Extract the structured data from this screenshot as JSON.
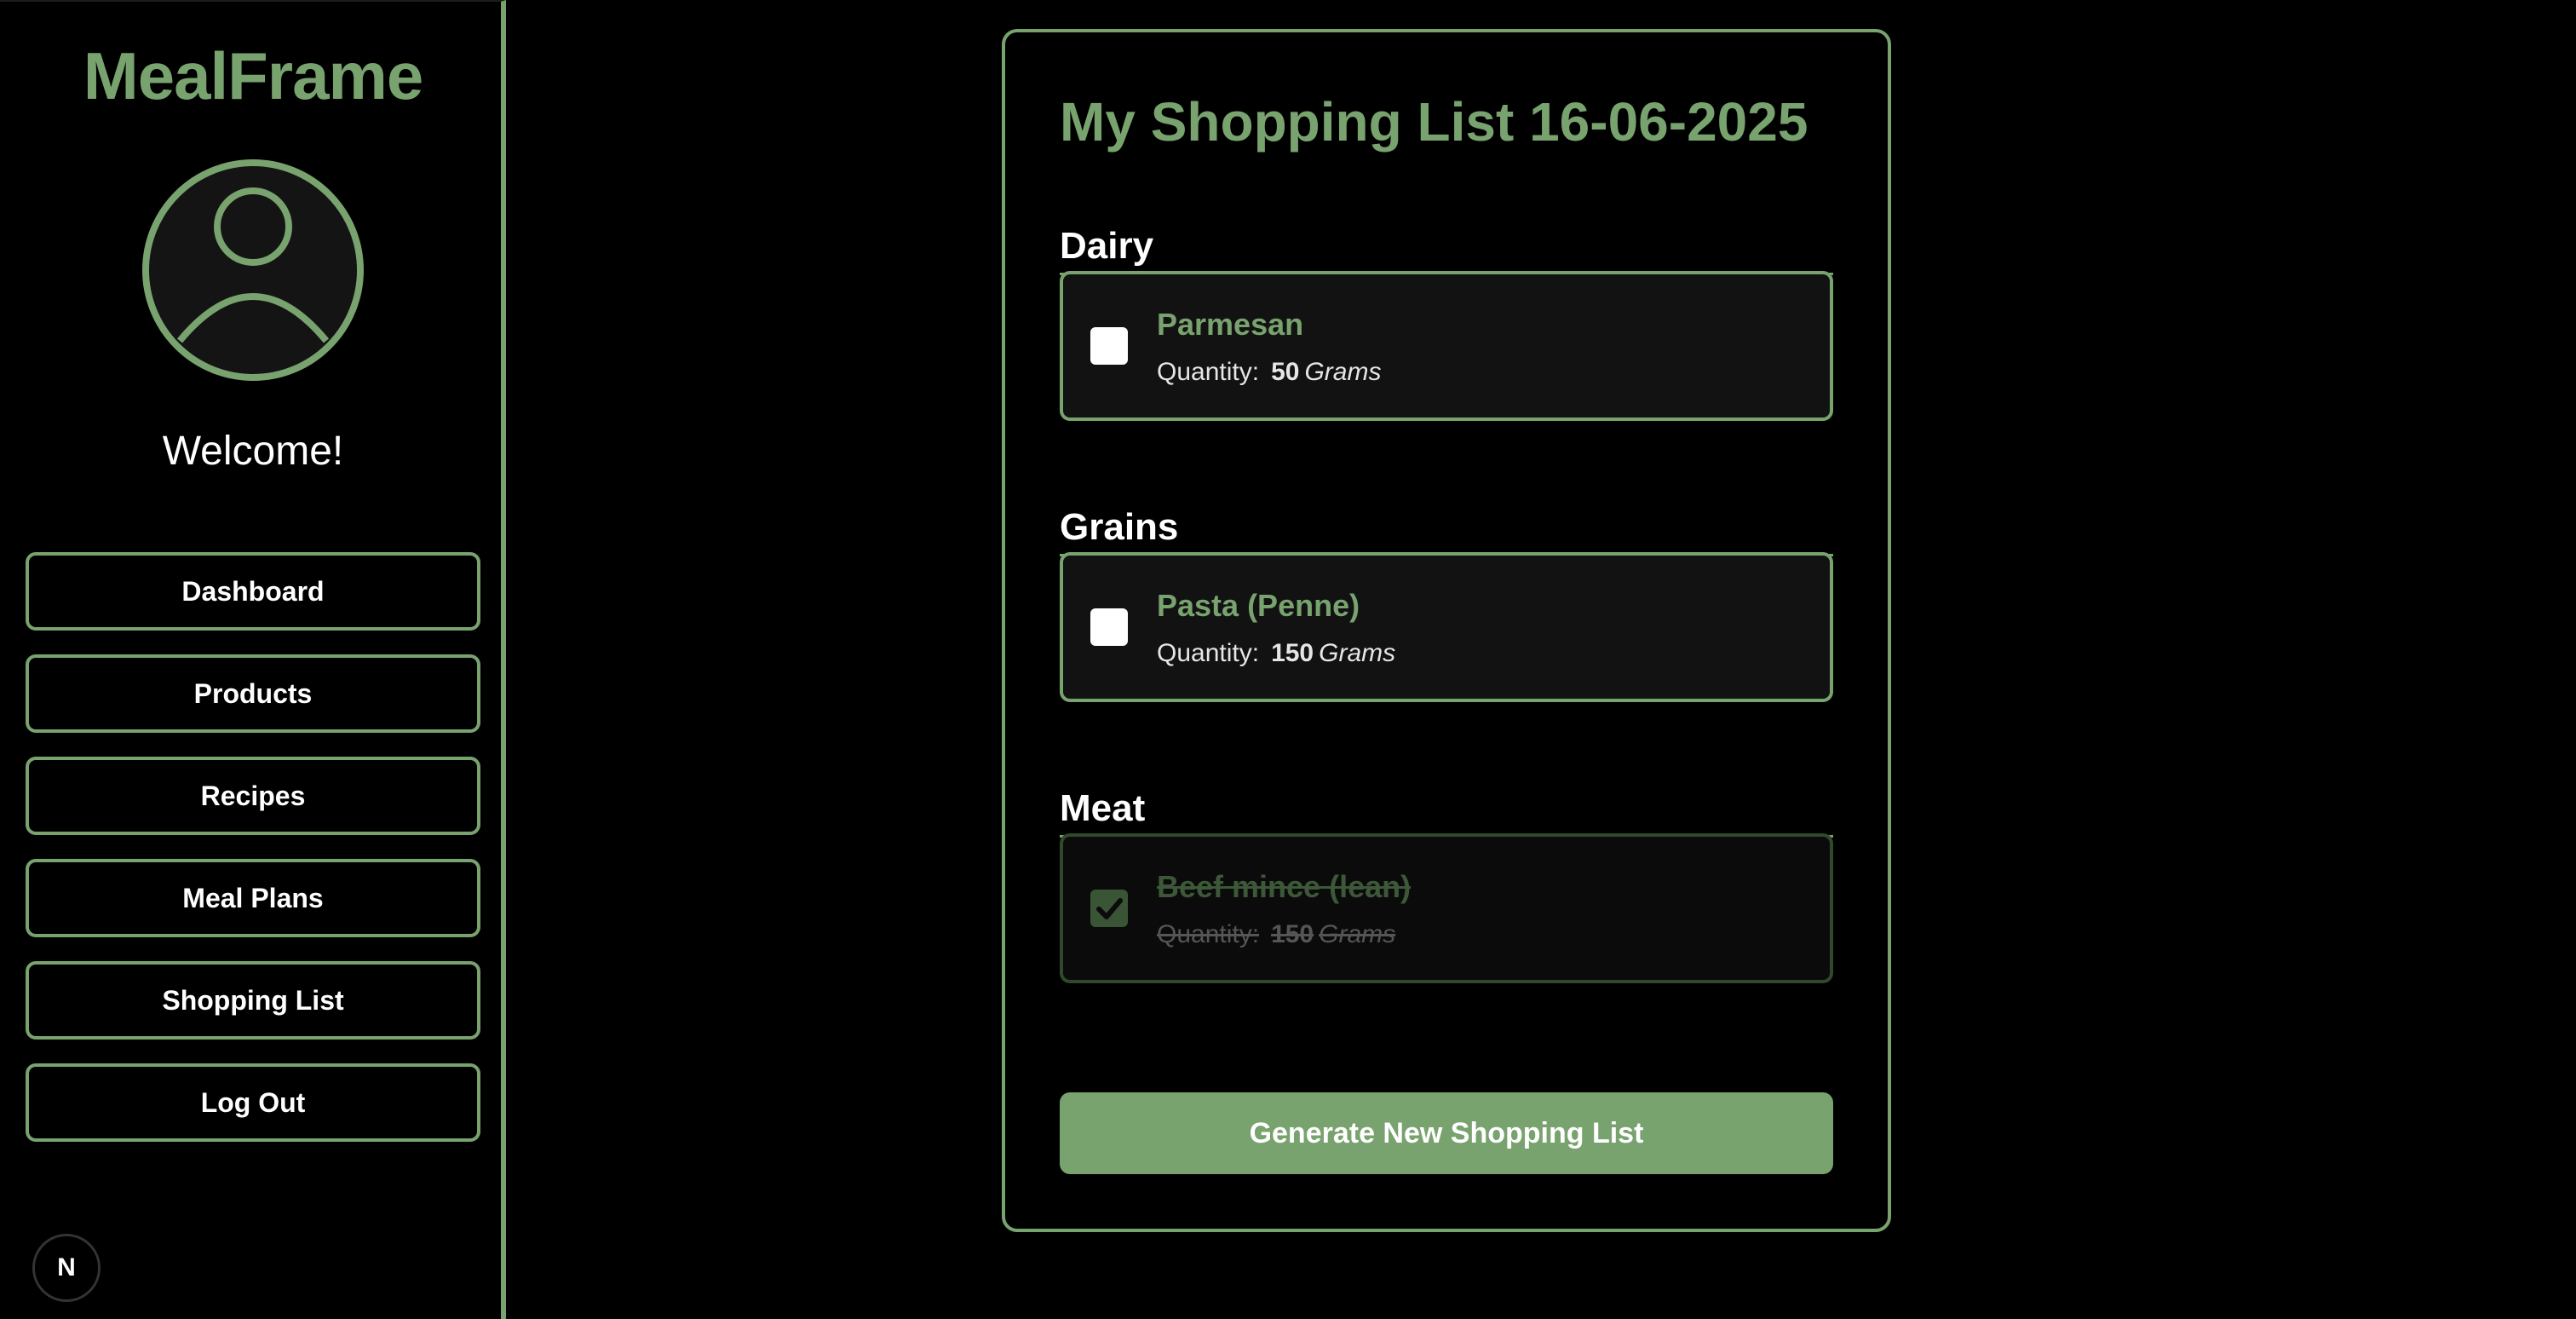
{
  "sidebar": {
    "brand": "MealFrame",
    "welcome": "Welcome!",
    "nav": [
      {
        "label": "Dashboard"
      },
      {
        "label": "Products"
      },
      {
        "label": "Recipes"
      },
      {
        "label": "Meal Plans"
      },
      {
        "label": "Shopping List"
      },
      {
        "label": "Log Out"
      }
    ],
    "badge": "N"
  },
  "main": {
    "title": "My Shopping List 16-06-2025",
    "categories": [
      {
        "name": "Dairy",
        "items": [
          {
            "name": "Parmesan",
            "quantity_label": "Quantity:",
            "amount": "50",
            "unit": "Grams",
            "checked": false
          }
        ]
      },
      {
        "name": "Grains",
        "items": [
          {
            "name": "Pasta (Penne)",
            "quantity_label": "Quantity:",
            "amount": "150",
            "unit": "Grams",
            "checked": false
          }
        ]
      },
      {
        "name": "Meat",
        "items": [
          {
            "name": "Beef mince (lean)",
            "quantity_label": "Quantity:",
            "amount": "150",
            "unit": "Grams",
            "checked": true
          }
        ]
      }
    ],
    "generate_button": "Generate New Shopping List"
  },
  "colors": {
    "accent": "#78a26e",
    "background": "#000000",
    "card": "#121212"
  },
  "icons": {
    "avatar": "user-avatar-icon",
    "checkmark": "check-icon",
    "framework_badge": "nextjs-icon"
  }
}
